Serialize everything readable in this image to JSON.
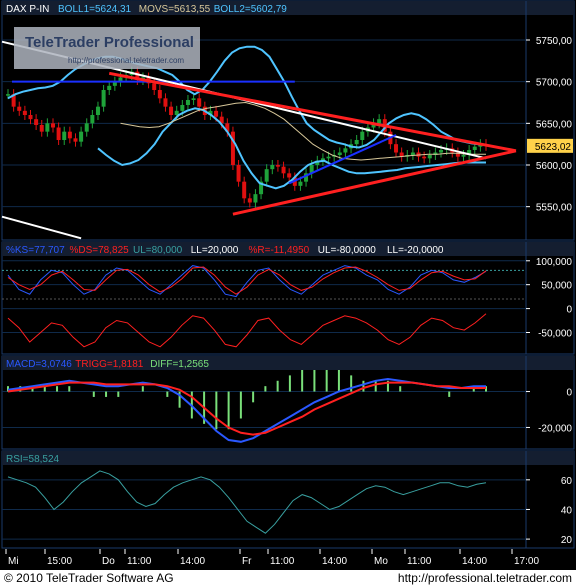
{
  "window": {
    "footer_left": "© 2010 TeleTrader Software AG",
    "footer_right": "http://professional.teletrader.com"
  },
  "watermark": {
    "title": "TeleTrader Professional",
    "url": "http://professional.teletrader.com"
  },
  "colors": {
    "background": "#000000",
    "panel_border": "#1a3a6a",
    "grid": "#0f2a4a",
    "price_up": "#1fa33a",
    "price_down": "#e01010",
    "boll": "#4fc4ff",
    "movs": "#d8c89a",
    "trend_red": "#ff2020",
    "trend_white": "#ffffff",
    "trend_blue": "#1a30ff",
    "k_line": "#2a58ff",
    "d_line": "#ff2020",
    "rsi_line": "#39a0a0",
    "macd_line": "#2a58ff",
    "trigg_line": "#ff2020",
    "hist": "#7ae07a",
    "price_tag_bg": "#ffd24a"
  },
  "chart_data": [
    {
      "type": "line",
      "panel": "price",
      "legend": [
        {
          "text": "DAX P-IN",
          "color": "#ffffff"
        },
        {
          "text": "BOLL1=5624,31",
          "color": "#4fc4ff"
        },
        {
          "text": "MOVS=5613,55",
          "color": "#d8c89a"
        },
        {
          "text": "BOLL2=5602,79",
          "color": "#4fc4ff"
        }
      ],
      "ylim": [
        5510,
        5780
      ],
      "yticks": [
        5550,
        5600,
        5650,
        5700,
        5750
      ],
      "ytick_labels": [
        "5550,00",
        "5600,00",
        "5650,00",
        "5700,00",
        "5750,00"
      ],
      "last_price_label": "5623,02",
      "last_price": 5623,
      "series": [
        {
          "role": "price",
          "values": [
            5685,
            5670,
            5665,
            5660,
            5655,
            5648,
            5640,
            5650,
            5645,
            5630,
            5640,
            5632,
            5628,
            5640,
            5650,
            5660,
            5670,
            5690,
            5695,
            5700,
            5705,
            5708,
            5712,
            5702,
            5705,
            5698,
            5690,
            5680,
            5670,
            5660,
            5665,
            5672,
            5678,
            5680,
            5670,
            5660,
            5665,
            5658,
            5650,
            5640,
            5600,
            5580,
            5560,
            5555,
            5565,
            5580,
            5595,
            5600,
            5598,
            5590,
            5585,
            5575,
            5580,
            5590,
            5600,
            5605,
            5608,
            5610,
            5612,
            5615,
            5620,
            5625,
            5630,
            5640,
            5645,
            5650,
            5655,
            5640,
            5625,
            5615,
            5610,
            5612,
            5615,
            5610,
            5608,
            5612,
            5615,
            5618,
            5620,
            5615,
            5610,
            5612,
            5618,
            5622,
            5625,
            5623
          ]
        },
        {
          "role": "boll1",
          "values": [
            5680,
            5685,
            5688,
            5690,
            5692,
            5693,
            5695,
            5700,
            5708,
            5715,
            5720,
            5725,
            5728,
            5730,
            5730,
            5728,
            5725,
            5722,
            5720,
            5718,
            5716,
            5712,
            5708,
            5700,
            5690,
            5685,
            5690,
            5700,
            5712,
            5725,
            5735,
            5740,
            5742,
            5742,
            5738,
            5730,
            5715,
            5700,
            5682,
            5665,
            5650,
            5642,
            5636,
            5630,
            5627,
            5625,
            5622,
            5621,
            5624,
            5630,
            5640,
            5650,
            5656,
            5660,
            5662,
            5660,
            5655,
            5648,
            5640,
            5635,
            5630,
            5628,
            5626,
            5625,
            5624
          ]
        },
        {
          "role": "boll2",
          "values": [
            5620,
            5612,
            5605,
            5600,
            5602,
            5606,
            5614,
            5625,
            5640,
            5650,
            5660,
            5665,
            5668,
            5666,
            5660,
            5652,
            5640,
            5625,
            5605,
            5590,
            5578,
            5575,
            5572,
            5575,
            5582,
            5592,
            5600,
            5604,
            5605,
            5600,
            5596,
            5592,
            5590,
            5590,
            5591,
            5592,
            5593,
            5594,
            5596,
            5597,
            5598,
            5599,
            5600,
            5601,
            5602,
            5603,
            5603,
            5603,
            5603
          ]
        },
        {
          "role": "movs",
          "values": [
            5650,
            5648,
            5646,
            5645,
            5646,
            5650,
            5655,
            5660,
            5665,
            5668,
            5670,
            5672,
            5674,
            5675,
            5672,
            5668,
            5662,
            5655,
            5645,
            5635,
            5625,
            5618,
            5612,
            5608,
            5607,
            5606,
            5607,
            5608,
            5609,
            5610,
            5611,
            5612,
            5613,
            5613,
            5614,
            5614,
            5613,
            5613,
            5613
          ]
        }
      ]
    },
    {
      "type": "line",
      "panel": "stochastic",
      "legend": [
        {
          "text": "%KS=77,707",
          "color": "#2a58ff"
        },
        {
          "text": "%DS=78,825",
          "color": "#ff2020"
        },
        {
          "text": "UL=80,000",
          "color": "#39a0a0"
        },
        {
          "text": "LL=20,000",
          "color": "#ffffff"
        },
        {
          "text": "%R=-11,4950",
          "color": "#ff2020"
        },
        {
          "text": "UL=-80,0000",
          "color": "#ffffff"
        },
        {
          "text": "LL=-20,0000",
          "color": "#ffffff"
        }
      ],
      "ylim": [
        -95,
        110
      ],
      "yticks": [
        100,
        50,
        0,
        -50
      ],
      "ytick_labels": [
        "100,000",
        "50,000",
        "0",
        "-50,000"
      ],
      "series": [
        {
          "name": "%KS",
          "values": [
            70,
            40,
            30,
            60,
            80,
            75,
            50,
            30,
            40,
            70,
            85,
            80,
            60,
            40,
            30,
            50,
            70,
            90,
            85,
            60,
            30,
            25,
            55,
            80,
            85,
            60,
            40,
            30,
            50,
            70,
            80,
            90,
            85,
            70,
            60,
            40,
            30,
            45,
            70,
            80,
            75,
            60,
            55,
            65,
            78
          ]
        },
        {
          "name": "%DS",
          "values": [
            65,
            50,
            40,
            50,
            70,
            78,
            60,
            40,
            38,
            60,
            80,
            82,
            70,
            50,
            35,
            45,
            62,
            85,
            87,
            70,
            45,
            30,
            45,
            70,
            82,
            70,
            50,
            38,
            45,
            62,
            75,
            85,
            87,
            78,
            65,
            50,
            38,
            42,
            60,
            75,
            78,
            68,
            60,
            62,
            79
          ]
        },
        {
          "name": "%R",
          "values": [
            -20,
            -40,
            -70,
            -50,
            -30,
            -35,
            -60,
            -80,
            -70,
            -40,
            -25,
            -30,
            -50,
            -70,
            -80,
            -60,
            -35,
            -15,
            -20,
            -45,
            -75,
            -80,
            -55,
            -25,
            -20,
            -45,
            -65,
            -75,
            -55,
            -35,
            -25,
            -15,
            -20,
            -30,
            -45,
            -65,
            -75,
            -60,
            -35,
            -20,
            -25,
            -40,
            -45,
            -30,
            -11
          ]
        }
      ]
    },
    {
      "type": "line",
      "panel": "macd",
      "legend": [
        {
          "text": "MACD=3,0746",
          "color": "#2a58ff"
        },
        {
          "text": "TRIGG=1,8181",
          "color": "#ff2020"
        },
        {
          "text": "DIFF=1,2565",
          "color": "#7ae07a"
        }
      ],
      "ylim": [
        -32,
        12
      ],
      "yticks": [
        0,
        -20
      ],
      "ytick_labels": [
        "0",
        "-20,000"
      ],
      "series": [
        {
          "name": "MACD",
          "values": [
            1,
            2,
            3,
            4,
            5,
            6,
            5,
            4,
            3,
            3,
            4,
            5,
            4,
            2,
            -2,
            -8,
            -15,
            -22,
            -27,
            -28,
            -26,
            -22,
            -18,
            -14,
            -10,
            -6,
            -3,
            0,
            2,
            4,
            6,
            7,
            6,
            5,
            4,
            3,
            2,
            2,
            3,
            3
          ]
        },
        {
          "name": "TRIGG",
          "values": [
            0,
            1,
            2,
            3,
            4,
            5,
            5,
            5,
            4,
            4,
            4,
            4,
            4,
            3,
            1,
            -3,
            -9,
            -15,
            -20,
            -23,
            -24,
            -23,
            -20,
            -17,
            -14,
            -10,
            -7,
            -4,
            -1,
            2,
            4,
            5,
            5,
            5,
            4,
            3,
            3,
            2,
            2,
            2
          ]
        },
        {
          "name": "DIFF",
          "values": [
            1,
            1,
            1,
            1,
            1,
            1,
            0,
            -1,
            -1,
            -1,
            0,
            1,
            0,
            -1,
            -3,
            -5,
            -6,
            -7,
            -7,
            -5,
            -2,
            1,
            2,
            3,
            4,
            4,
            4,
            4,
            3,
            2,
            2,
            2,
            1,
            0,
            0,
            0,
            -1,
            0,
            1,
            1
          ]
        }
      ]
    },
    {
      "type": "line",
      "panel": "rsi",
      "legend": [
        {
          "text": "RSI=58,524",
          "color": "#39a0a0"
        }
      ],
      "ylim": [
        14,
        70
      ],
      "yticks": [
        60,
        40,
        20
      ],
      "ytick_labels": [
        "60",
        "40",
        "20"
      ],
      "series": [
        {
          "name": "RSI",
          "values": [
            62,
            60,
            58,
            55,
            48,
            40,
            45,
            52,
            58,
            62,
            66,
            64,
            60,
            52,
            45,
            42,
            44,
            50,
            55,
            58,
            60,
            62,
            60,
            55,
            48,
            40,
            32,
            28,
            24,
            30,
            38,
            46,
            50,
            48,
            44,
            40,
            42,
            46,
            50,
            54,
            56,
            55,
            52,
            50,
            52,
            54,
            56,
            58,
            58,
            56,
            55,
            57,
            58
          ]
        }
      ]
    },
    {
      "type": "x_axis",
      "tick_labels": [
        "Mi",
        "15:00",
        "Do",
        "11:00",
        "14:00",
        "Fr",
        "11:00",
        "14:00",
        "Mo",
        "11:00",
        "14:00",
        "17:00"
      ]
    }
  ]
}
